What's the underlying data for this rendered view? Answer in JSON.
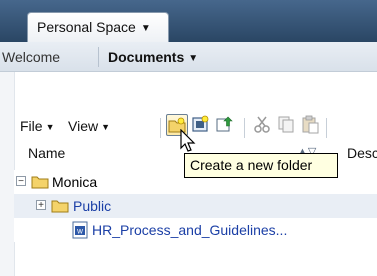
{
  "header": {
    "tab_label": "Personal Space",
    "welcome_label": "Welcome",
    "documents_label": "Documents"
  },
  "toolbar": {
    "file_label": "File",
    "view_label": "View",
    "icons": [
      "new-folder-icon",
      "new-document-icon",
      "upload-icon",
      "cut-icon",
      "copy-icon",
      "paste-icon"
    ]
  },
  "columns": {
    "name": "Name",
    "description": "Desc"
  },
  "tree": {
    "items": [
      {
        "label": "Monica",
        "type": "folder",
        "expanded": true
      },
      {
        "label": "Public",
        "type": "folder",
        "expanded": false
      },
      {
        "label": "HR_Process_and_Guidelines...",
        "type": "document"
      }
    ]
  },
  "tooltip": {
    "text": "Create a new folder"
  },
  "colors": {
    "topbar": "#2f4b6a",
    "link": "#1b3fa6",
    "tooltip_bg": "#ffffe1",
    "folder": "#f4d36a"
  }
}
